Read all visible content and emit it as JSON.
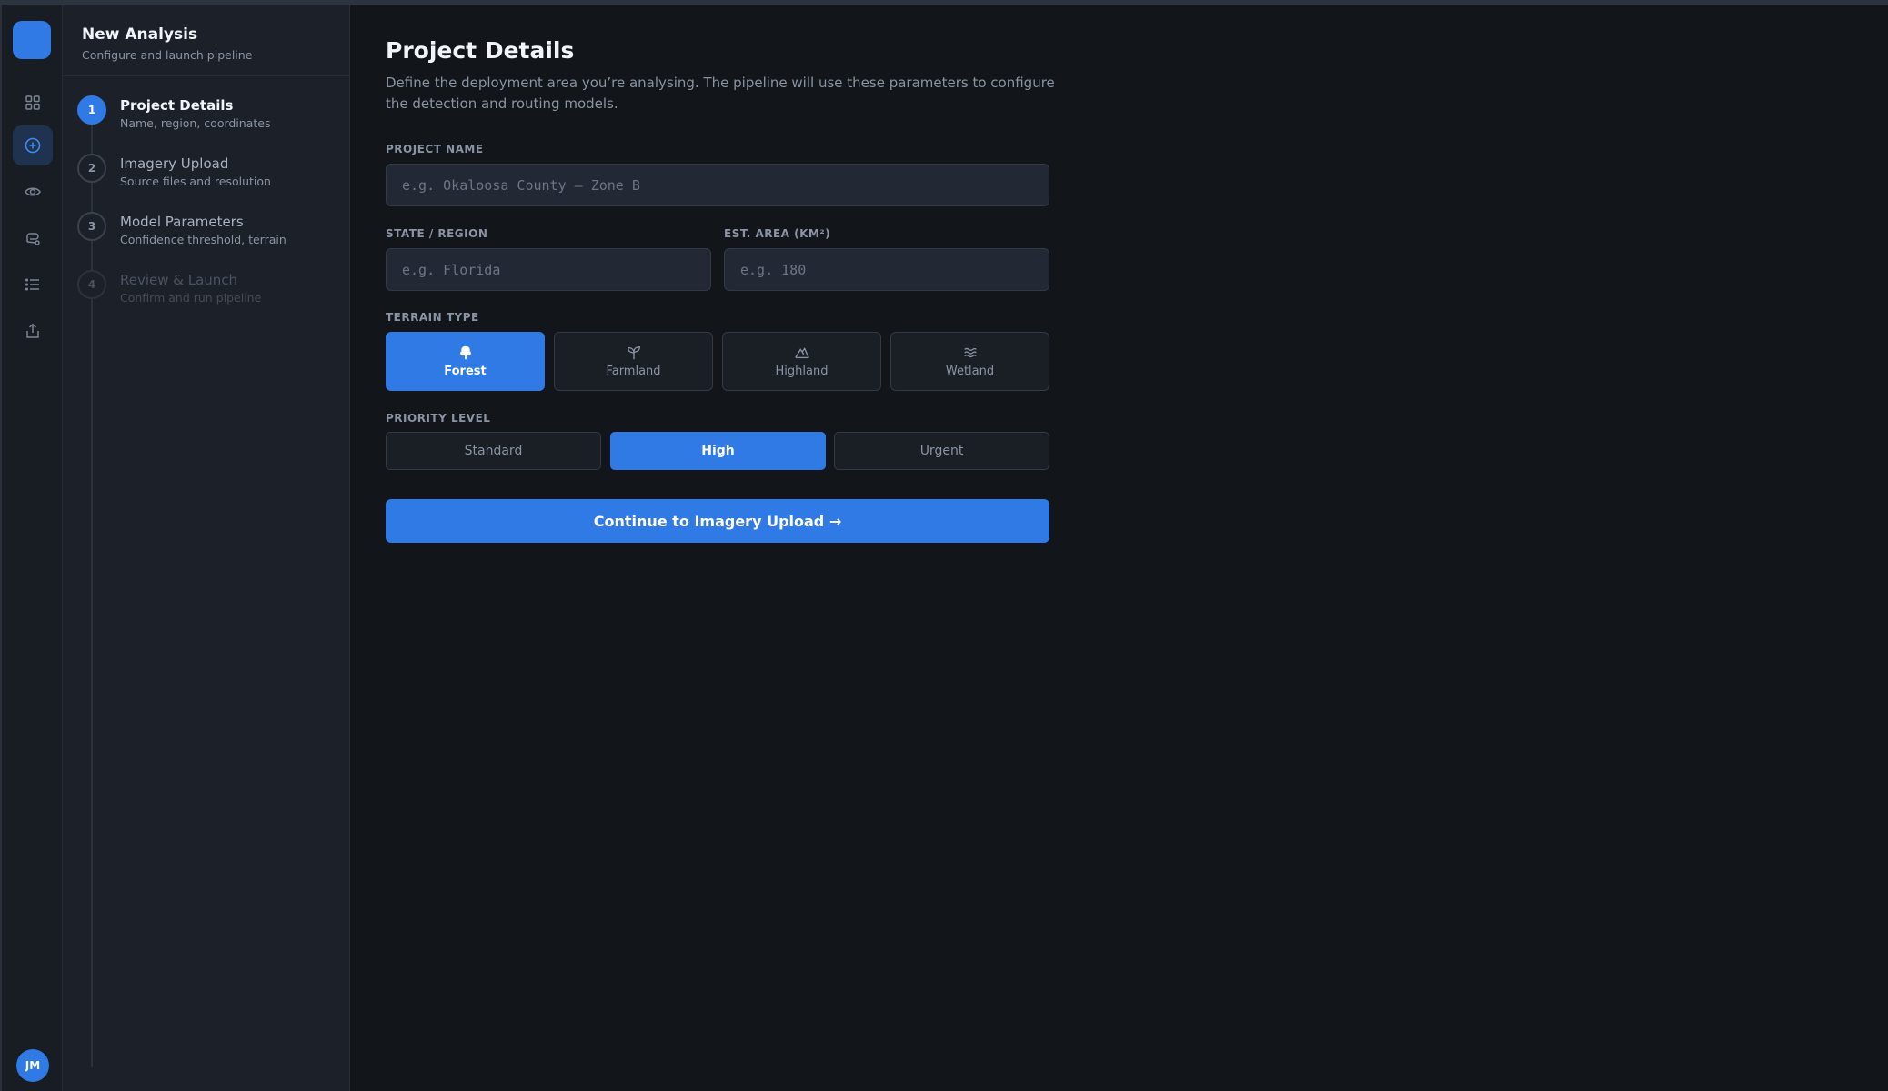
{
  "app": {
    "accent": "#2f7ae5",
    "user_initials": "JM"
  },
  "rail": {
    "items": [
      {
        "icon": "grid-icon"
      },
      {
        "icon": "plus-circle-icon",
        "active": true
      },
      {
        "icon": "eye-icon"
      },
      {
        "icon": "route-icon"
      },
      {
        "icon": "list-icon"
      },
      {
        "icon": "share-icon"
      }
    ]
  },
  "sidebar": {
    "title": "New Analysis",
    "subtitle": "Configure and launch pipeline",
    "steps": [
      {
        "num": "1",
        "title": "Project Details",
        "sub": "Name, region, coordinates",
        "state": "active"
      },
      {
        "num": "2",
        "title": "Imagery Upload",
        "sub": "Source files and resolution",
        "state": "pending"
      },
      {
        "num": "3",
        "title": "Model Parameters",
        "sub": "Confidence threshold, terrain",
        "state": "pending"
      },
      {
        "num": "4",
        "title": "Review & Launch",
        "sub": "Confirm and run pipeline",
        "state": "disabled"
      }
    ]
  },
  "main": {
    "title": "Project Details",
    "description": "Define the deployment area you’re analysing. The pipeline will use these parameters to configure the detection and routing models.",
    "project_name": {
      "label": "PROJECT NAME",
      "value": "",
      "placeholder": "e.g. Okaloosa County — Zone B"
    },
    "state_region": {
      "label": "STATE / REGION",
      "value": "",
      "placeholder": "e.g. Florida"
    },
    "est_area": {
      "label": "EST. AREA (KM²)",
      "value": "",
      "placeholder": "e.g. 180"
    },
    "terrain": {
      "label": "TERRAIN TYPE",
      "options": [
        {
          "label": "Forest",
          "icon": "tree-icon",
          "selected": true
        },
        {
          "label": "Farmland",
          "icon": "sprout-icon",
          "selected": false
        },
        {
          "label": "Highland",
          "icon": "mountain-icon",
          "selected": false
        },
        {
          "label": "Wetland",
          "icon": "waves-icon",
          "selected": false
        }
      ]
    },
    "priority": {
      "label": "PRIORITY LEVEL",
      "options": [
        {
          "label": "Standard",
          "selected": false
        },
        {
          "label": "High",
          "selected": true
        },
        {
          "label": "Urgent",
          "selected": false
        }
      ]
    },
    "continue_label": "Continue to Imagery Upload →"
  }
}
